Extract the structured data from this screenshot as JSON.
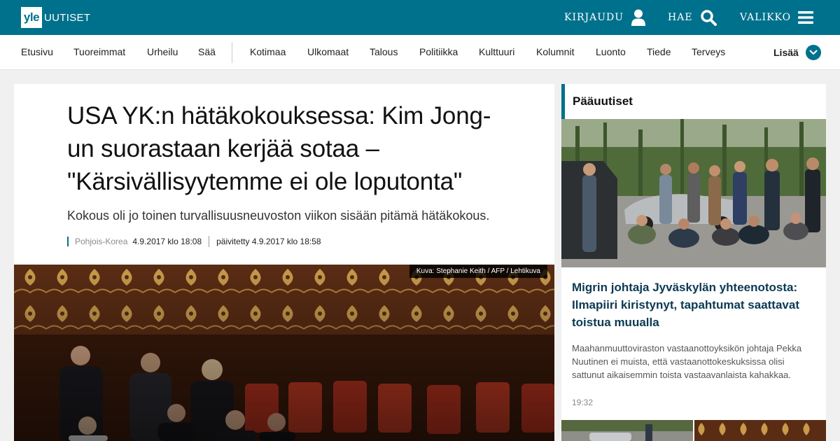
{
  "header": {
    "logo_mark": "yle",
    "logo_text": "UUTISET",
    "login_label": "KIRJAUDU",
    "search_label": "HAE",
    "menu_label": "VALIKKO",
    "brand_color": "#00718c"
  },
  "nav": {
    "items": [
      "Etusivu",
      "Tuoreimmat",
      "Urheilu",
      "Sää",
      "Kotimaa",
      "Ulkomaat",
      "Talous",
      "Politiikka",
      "Kulttuuri",
      "Kolumnit",
      "Luonto",
      "Tiede",
      "Terveys"
    ],
    "more_label": "Lisää"
  },
  "article": {
    "headline": "USA YK:n hätäkokouksessa: Kim Jong-un suorastaan kerjää sotaa – \"Kärsivällisyytemme ei ole loputonta\"",
    "lead": "Kokous oli jo toinen turvallisuusneuvoston viikon sisään pitämä hätäkokous.",
    "category": "Pohjois-Korea",
    "published": "4.9.2017 klo 18:08",
    "updated": "päivitetty 4.9.2017 klo 18:58",
    "image_credit": "Kuva: Stephanie Keith / AFP / Lehtikuva"
  },
  "sidebar": {
    "heading": "Pääuutiset",
    "story": {
      "title": "Migrin johtaja Jyväskylän yhteenotosta: Ilmapiiri kiristynyt, tapahtumat saattavat toistua muualla",
      "description": "Maahanmuuttoviraston vastaanottoyksikön johtaja Pekka Nuutinen ei muista, että vastaanottokeskuksissa olisi sattunut aikaisemmin toista vastaavanlaista kahakkaa.",
      "time": "19:32"
    }
  }
}
